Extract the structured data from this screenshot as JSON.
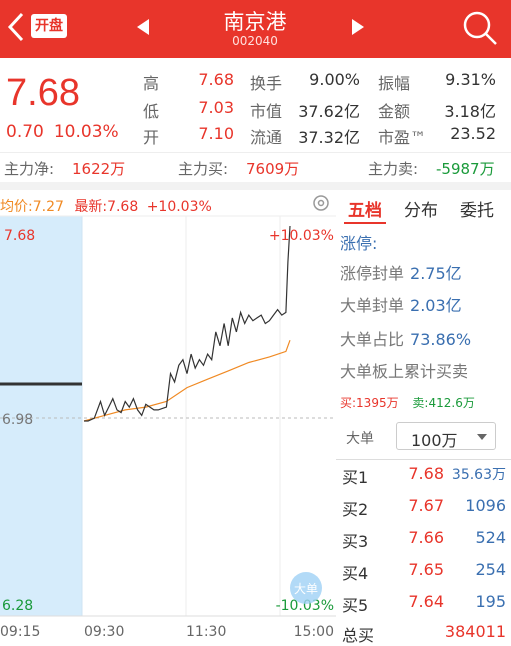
{
  "header": {
    "open_badge": "开盘",
    "stock_name": "南京港",
    "stock_code": "002040"
  },
  "quote": {
    "price": "7.68",
    "change": "0.70",
    "change_pct": "10.03%",
    "stats": [
      {
        "label": "高",
        "value": "7.68",
        "color": "red"
      },
      {
        "label": "换手",
        "value": "9.00%",
        "color": "dark"
      },
      {
        "label": "振幅",
        "value": "9.31%",
        "color": "dark"
      },
      {
        "label": "低",
        "value": "7.03",
        "color": "red"
      },
      {
        "label": "市值",
        "value": "37.62亿",
        "color": "dark"
      },
      {
        "label": "金额",
        "value": "3.18亿",
        "color": "dark"
      },
      {
        "label": "开",
        "value": "7.10",
        "color": "red"
      },
      {
        "label": "流通",
        "value": "37.32亿",
        "color": "dark"
      },
      {
        "label": "市盈™",
        "value": "23.52",
        "color": "dark"
      }
    ]
  },
  "flow": {
    "net_label": "主力净:",
    "net_value": "1622万",
    "buy_label": "主力买:",
    "buy_value": "7609万",
    "sell_label": "主力卖:",
    "sell_value": "-5987万"
  },
  "legend": {
    "avg_label": "均价:",
    "avg_value": "7.27",
    "latest_label": "最新:",
    "latest_value": "7.68",
    "latest_pct": "+10.03%"
  },
  "chart_data": {
    "type": "line",
    "series": [
      {
        "name": "最新",
        "color": "#333333"
      },
      {
        "name": "均价",
        "color": "#f08a24"
      }
    ],
    "price_points": [
      [
        0,
        6.98
      ],
      [
        0.02,
        6.98
      ],
      [
        0.05,
        6.99
      ],
      [
        0.08,
        7.05
      ],
      [
        0.1,
        7.0
      ],
      [
        0.12,
        7.03
      ],
      [
        0.14,
        7.06
      ],
      [
        0.16,
        7.02
      ],
      [
        0.18,
        7.01
      ],
      [
        0.2,
        7.05
      ],
      [
        0.22,
        7.03
      ],
      [
        0.24,
        7.06
      ],
      [
        0.26,
        7.02
      ],
      [
        0.28,
        7.0
      ],
      [
        0.3,
        7.04
      ],
      [
        0.32,
        7.03
      ],
      [
        0.34,
        7.02
      ],
      [
        0.36,
        7.02
      ],
      [
        0.4,
        7.03
      ],
      [
        0.42,
        7.15
      ],
      [
        0.44,
        7.12
      ],
      [
        0.46,
        7.18
      ],
      [
        0.48,
        7.2
      ],
      [
        0.5,
        7.15
      ],
      [
        0.52,
        7.22
      ],
      [
        0.54,
        7.17
      ],
      [
        0.56,
        7.2
      ],
      [
        0.58,
        7.18
      ],
      [
        0.6,
        7.22
      ],
      [
        0.62,
        7.2
      ],
      [
        0.64,
        7.3
      ],
      [
        0.66,
        7.25
      ],
      [
        0.68,
        7.33
      ],
      [
        0.7,
        7.25
      ],
      [
        0.72,
        7.35
      ],
      [
        0.74,
        7.3
      ],
      [
        0.76,
        7.37
      ],
      [
        0.78,
        7.33
      ],
      [
        0.8,
        7.36
      ],
      [
        0.82,
        7.34
      ],
      [
        0.84,
        7.35
      ],
      [
        0.86,
        7.36
      ],
      [
        0.88,
        7.33
      ],
      [
        0.9,
        7.34
      ],
      [
        0.92,
        7.36
      ],
      [
        0.94,
        7.38
      ],
      [
        0.96,
        7.36
      ],
      [
        0.98,
        7.37
      ],
      [
        0.99,
        7.55
      ],
      [
        1.0,
        7.68
      ]
    ],
    "avg_points": [
      [
        0,
        6.98
      ],
      [
        0.1,
        7.0
      ],
      [
        0.2,
        7.02
      ],
      [
        0.3,
        7.03
      ],
      [
        0.4,
        7.05
      ],
      [
        0.5,
        7.1
      ],
      [
        0.6,
        7.13
      ],
      [
        0.7,
        7.16
      ],
      [
        0.8,
        7.19
      ],
      [
        0.9,
        7.21
      ],
      [
        0.98,
        7.23
      ],
      [
        1.0,
        7.27
      ]
    ],
    "y_max_label": "7.68",
    "y_mid_label": "6.98",
    "y_min_label": "6.28",
    "pct_max_label": "+10.03%",
    "pct_min_label": "-10.03%",
    "x_labels": [
      "09:15",
      "09:30",
      "11:30",
      "15:00"
    ],
    "ylim": [
      6.28,
      7.68
    ],
    "big_order_tag": "大单"
  },
  "tabs": [
    "五档",
    "分布",
    "委托"
  ],
  "limit_panel": {
    "title": "涨停:",
    "rows": [
      {
        "label": "涨停封单",
        "value": "2.75亿"
      },
      {
        "label": "大单封单",
        "value": "2.03亿"
      },
      {
        "label": "大单占比",
        "value": "73.86%"
      },
      {
        "label": "大单板上累计买卖",
        "value": ""
      }
    ],
    "buy_label": "买:",
    "buy_value": "1395万",
    "sell_label": "卖:",
    "sell_value": "412.6万"
  },
  "dropdown": {
    "label": "大单",
    "value": "100万"
  },
  "bids": [
    {
      "label": "买1",
      "price": "7.68",
      "volume": "35.63万"
    },
    {
      "label": "买2",
      "price": "7.67",
      "volume": "1096"
    },
    {
      "label": "买3",
      "price": "7.66",
      "volume": "524"
    },
    {
      "label": "买4",
      "price": "7.65",
      "volume": "254"
    },
    {
      "label": "买5",
      "price": "7.64",
      "volume": "195"
    }
  ],
  "total_buy": {
    "label": "总买",
    "value": "384011"
  }
}
